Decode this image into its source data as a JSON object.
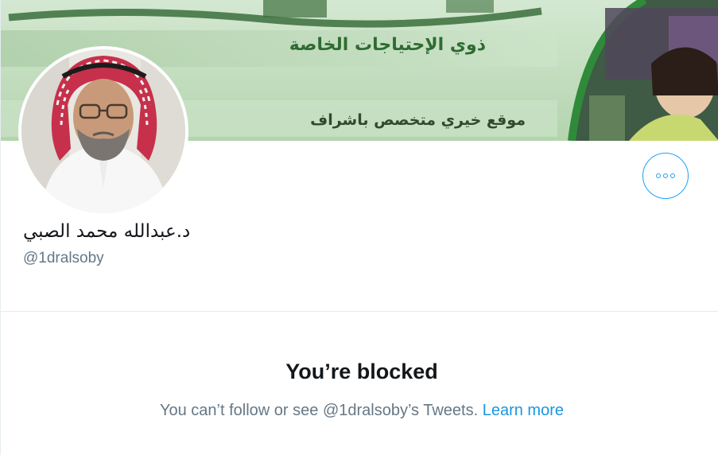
{
  "banner": {
    "line_top": "ذوي الإحتياجات الخاصة",
    "line_bottom": "موقع خيري متخصص باشراف"
  },
  "profile": {
    "display_name": "د.عبدالله محمد الصبي",
    "handle": "@1dralsoby"
  },
  "actions": {
    "more_icon": "more-horizontal-icon",
    "accent_color": "#1da1f2"
  },
  "blocked": {
    "title": "You’re blocked",
    "description": "You can’t follow or see @1dralsoby’s Tweets.",
    "learn_more": "Learn more"
  }
}
